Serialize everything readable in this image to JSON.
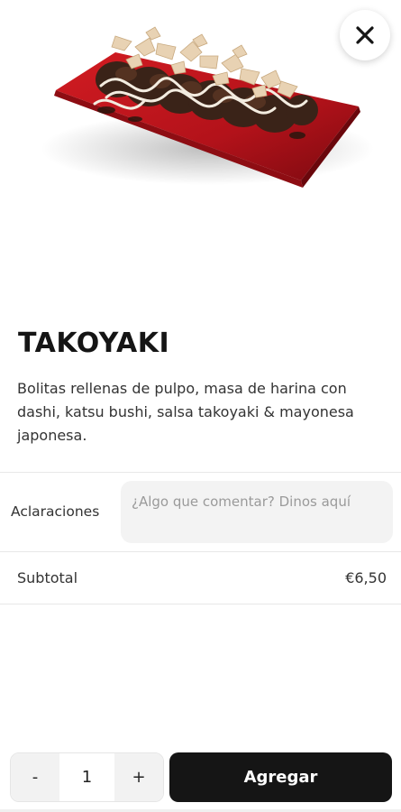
{
  "product": {
    "title": "TAKOYAKI",
    "description": "Bolitas rellenas de pulpo, masa de harina con dashi, katsu bushi, salsa takoyaki & mayonesa japonesa."
  },
  "notes": {
    "label": "Aclaraciones",
    "placeholder": "¿Algo que comentar? Dinos aquí"
  },
  "subtotal": {
    "label": "Subtotal",
    "value": "€6,50"
  },
  "order": {
    "decrement": "-",
    "quantity": "1",
    "increment": "+",
    "add_label": "Agregar"
  },
  "icons": {
    "close": "close-icon"
  },
  "colors": {
    "plate": "#c0161d",
    "primary_button": "#151515"
  }
}
